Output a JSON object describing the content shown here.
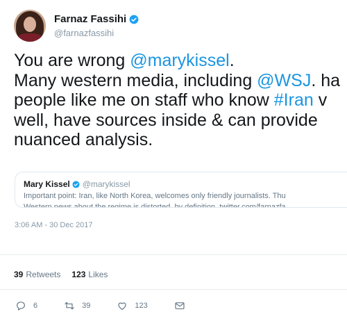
{
  "author": {
    "display_name": "Farnaz Fassihi",
    "handle": "@farnazfassihi"
  },
  "tweet": {
    "lines": [
      [
        {
          "text": "You are wrong ",
          "link": false
        },
        {
          "text": "@marykissel",
          "link": true
        },
        {
          "text": ".",
          "link": false
        }
      ],
      [
        {
          "text": "Many western media, including ",
          "link": false
        },
        {
          "text": "@WSJ",
          "link": true
        },
        {
          "text": ". ha",
          "link": false
        }
      ],
      [
        {
          "text": "people like me on staff who know ",
          "link": false
        },
        {
          "text": "#Iran",
          "link": true
        },
        {
          "text": " v",
          "link": false
        }
      ],
      [
        {
          "text": "well, have sources inside & can provide",
          "link": false
        }
      ],
      [
        {
          "text": "nuanced analysis.",
          "link": false
        }
      ]
    ]
  },
  "quoted_tweet": {
    "display_name": "Mary Kissel",
    "handle": "@marykissel",
    "line1": "Important point: Iran, like North Korea, welcomes only friendly journalists. Thu",
    "line2": "Western news about the regime is distorted, by definition. twitter.com/farnazfa"
  },
  "timestamp": "3:06 AM - 30 Dec 2017",
  "stats": {
    "retweets_count": "39",
    "retweets_label": "Retweets",
    "likes_count": "123",
    "likes_label": "Likes"
  },
  "actions": {
    "reply_count": "6",
    "retweet_count": "39",
    "like_count": "123"
  },
  "colors": {
    "link": "#1b95e0",
    "verified": "#1da1f2",
    "muted": "#8899a6",
    "text": "#14171a"
  }
}
